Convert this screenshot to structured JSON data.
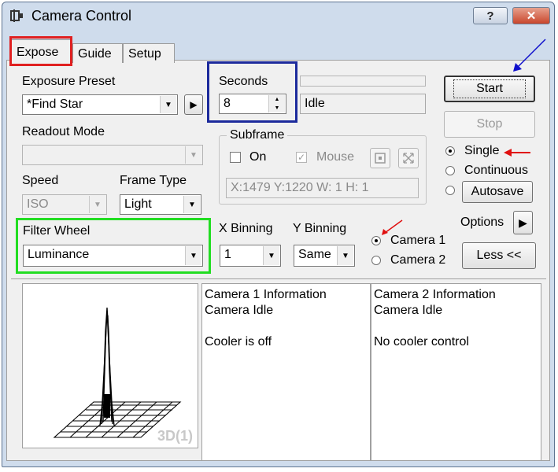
{
  "window": {
    "title": "Camera Control",
    "help_label": "?",
    "close_label": "✕"
  },
  "tabs": [
    {
      "label": "Expose",
      "active": true
    },
    {
      "label": "Guide"
    },
    {
      "label": "Setup"
    }
  ],
  "exposure_preset": {
    "label": "Exposure Preset",
    "value": "*Find Star"
  },
  "seconds": {
    "label": "Seconds",
    "value": "8"
  },
  "status": {
    "value": "Idle"
  },
  "readout_mode": {
    "label": "Readout Mode",
    "value": ""
  },
  "subframe": {
    "title": "Subframe",
    "on_label": "On",
    "mouse_label": "Mouse",
    "coords": "X:1479 Y:1220 W:  1 H:  1"
  },
  "speed": {
    "label": "Speed",
    "value": "ISO"
  },
  "frame_type": {
    "label": "Frame Type",
    "value": "Light"
  },
  "filter_wheel": {
    "label": "Filter Wheel",
    "value": "Luminance"
  },
  "x_binning": {
    "label": "X Binning",
    "value": "1"
  },
  "y_binning": {
    "label": "Y Binning",
    "value": "Same"
  },
  "cameras": {
    "camera1": "Camera 1",
    "camera2": "Camera 2",
    "selected": "camera1"
  },
  "buttons": {
    "start": "Start",
    "stop": "Stop",
    "autosave": "Autosave",
    "options": "Options",
    "less": "Less <<"
  },
  "mode": {
    "single": "Single",
    "continuous": "Continuous",
    "selected": "single"
  },
  "preview": {
    "label": "3D(1)"
  },
  "camera1_info": {
    "line1": "Camera 1 Information",
    "line2": "Camera Idle",
    "line3": "Cooler is off"
  },
  "camera2_info": {
    "line1": "Camera 2 Information",
    "line2": "Camera Idle",
    "line3": "No cooler control"
  },
  "colors": {
    "highlight_red": "#e02020",
    "highlight_blue": "#1c2a9c",
    "highlight_green": "#22dd22",
    "arrow_red": "#e01010",
    "arrow_blue": "#1010cc"
  }
}
